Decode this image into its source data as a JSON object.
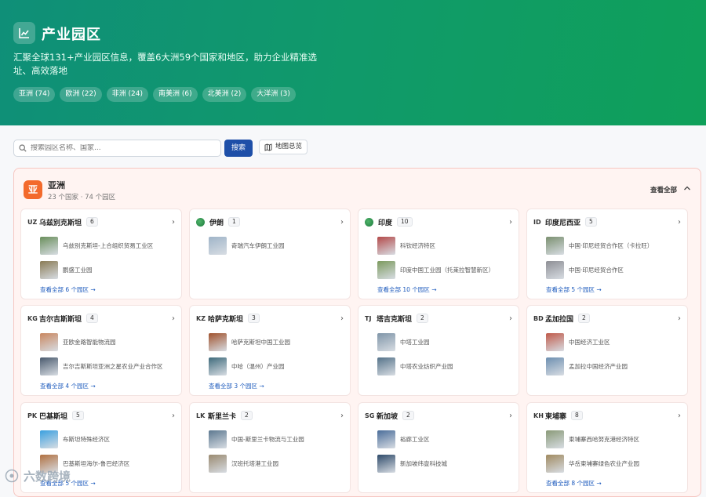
{
  "hero": {
    "title": "产业园区",
    "description": "汇聚全球131+产业园区信息，覆盖6大洲59个国家和地区，助力企业精准选址、高效落地",
    "tags": [
      "亚洲 (74)",
      "欧洲 (22)",
      "非洲 (24)",
      "南美洲 (6)",
      "北美洲 (2)",
      "大洋洲 (3)"
    ]
  },
  "search": {
    "placeholder": "搜索园区名称、国家...",
    "button": "搜索",
    "map_button": "地图总览"
  },
  "region": {
    "badge": "亚",
    "name": "亚洲",
    "subtitle": "23 个国家 · 74 个园区",
    "view_all": "查看全部"
  },
  "countries": [
    {
      "code": "UZ",
      "name": "乌兹别克斯坦",
      "count": "6",
      "parks": [
        "乌兹别克斯坦-上合组织贸易工业区",
        "鹏盛工业园"
      ],
      "more": "查看全部 6 个园区 →"
    },
    {
      "code": "",
      "name": "伊朗",
      "count": "1",
      "parks": [
        "奇瑞汽车伊朗工业园"
      ],
      "more": ""
    },
    {
      "code": "",
      "name": "印度",
      "count": "10",
      "parks": [
        "科钦经济特区",
        "印度中国工业园（托莱拉智慧新区）"
      ],
      "more": "查看全部 10 个园区 →"
    },
    {
      "code": "ID",
      "name": "印度尼西亚",
      "count": "5",
      "parks": [
        "中国·印尼经贸合作区（卡拉旺）",
        "中国·印尼经贸合作区"
      ],
      "more": "查看全部 5 个园区 →"
    },
    {
      "code": "KG",
      "name": "吉尔吉斯斯坦",
      "count": "4",
      "parks": [
        "亚欧金路智能物流园",
        "吉尔吉斯斯坦亚洲之星农业产业合作区"
      ],
      "more": "查看全部 4 个园区 →"
    },
    {
      "code": "KZ",
      "name": "哈萨克斯坦",
      "count": "3",
      "parks": [
        "哈萨克斯坦中国工业园",
        "中哈（温州）产业园"
      ],
      "more": "查看全部 3 个园区 →"
    },
    {
      "code": "TJ",
      "name": "塔吉克斯坦",
      "count": "2",
      "parks": [
        "中塔工业园",
        "中塔农业纺织产业园"
      ],
      "more": ""
    },
    {
      "code": "BD",
      "name": "孟加拉国",
      "count": "2",
      "parks": [
        "中国经济工业区",
        "孟加拉中国经济产业园"
      ],
      "more": ""
    },
    {
      "code": "PK",
      "name": "巴基斯坦",
      "count": "5",
      "parks": [
        "布斯坦特殊经济区",
        "巴基斯坦海尔-鲁巴经济区"
      ],
      "more": "查看全部 5 个园区 →"
    },
    {
      "code": "LK",
      "name": "斯里兰卡",
      "count": "2",
      "parks": [
        "中国-斯里兰卡物流与工业园",
        "汉班托塔港工业园"
      ],
      "more": ""
    },
    {
      "code": "SG",
      "name": "新加坡",
      "count": "2",
      "parks": [
        "裕廊工业区",
        "新加坡纬壹科技城"
      ],
      "more": ""
    },
    {
      "code": "KH",
      "name": "柬埔寨",
      "count": "8",
      "parks": [
        "柬埔寨西哈努克港经济特区",
        "华岳柬埔寨绿色农业产业园"
      ],
      "more": "查看全部 8 个园区 →"
    }
  ],
  "colors": {
    "hero_start": "#0f8f78",
    "hero_end": "#0fa05a",
    "accent_blue": "#1e4fa8",
    "region_badge": "#f36a2c",
    "region_bg": "#fff4f2",
    "link": "#1e5bbd"
  },
  "watermark": "六数跨境"
}
